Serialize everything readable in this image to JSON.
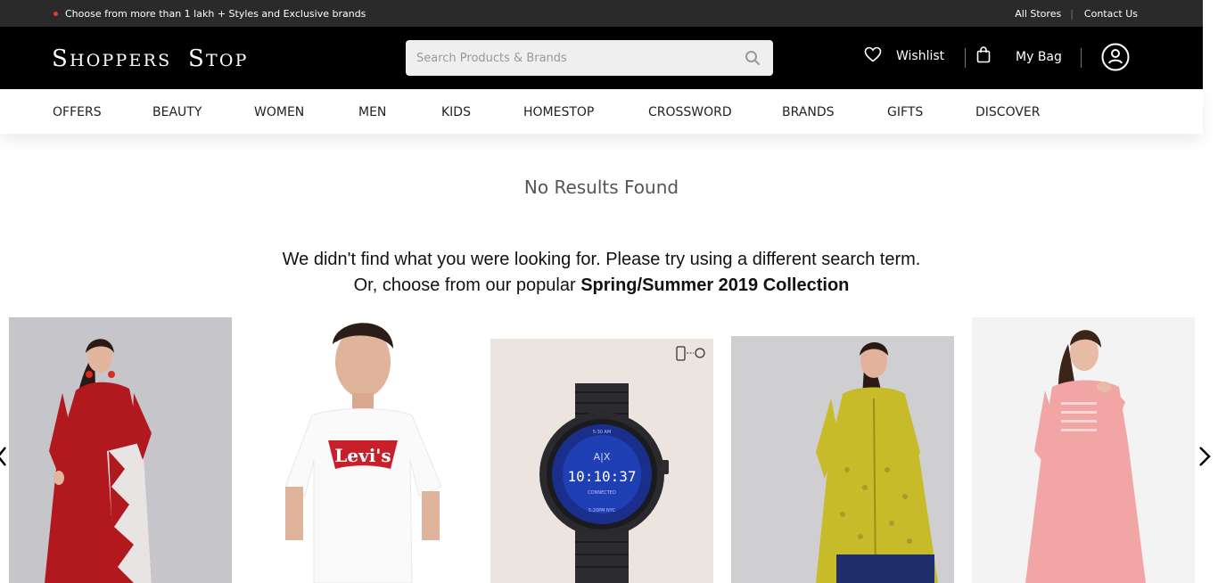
{
  "topbar": {
    "promo": "Choose from more than 1 lakh + Styles and Exclusive brands",
    "all_stores": "All Stores",
    "contact_us": "Contact Us"
  },
  "header": {
    "logo": "Shoppers Stop",
    "search": {
      "placeholder": "Search Products & Brands",
      "value": ""
    },
    "wishlist_label": "Wishlist",
    "bag_label": "My Bag"
  },
  "nav": [
    "OFFERS",
    "BEAUTY",
    "WOMEN",
    "MEN",
    "KIDS",
    "HOMESTOP",
    "CROSSWORD",
    "BRANDS",
    "GIFTS",
    "DISCOVER"
  ],
  "main": {
    "no_results_title": "No Results Found",
    "message_line1": "We didn't find what you were looking for. Please try using a different search term.",
    "message_line2_prefix": "Or, choose from our popular ",
    "collection_name": "Spring/Summer 2019 Collection"
  },
  "products": [
    {
      "name": "red-kurta",
      "color": "#b2191e"
    },
    {
      "name": "levis-tshirt",
      "brand_text": "Levi's"
    },
    {
      "name": "ax-smartwatch",
      "watch_brand": "A|X",
      "watch_time": "10:10:37",
      "watch_sub": "CONNECTED",
      "watch_date": "5:20PM NYC",
      "watch_top": "5:30 AM"
    },
    {
      "name": "yellow-kurta",
      "color": "#c8bb2a"
    },
    {
      "name": "pink-kurta",
      "color": "#f2a5a5"
    }
  ],
  "colors": {
    "topbar": "#2a2a2a",
    "header": "#000000",
    "accent_dot": "#e53935"
  }
}
